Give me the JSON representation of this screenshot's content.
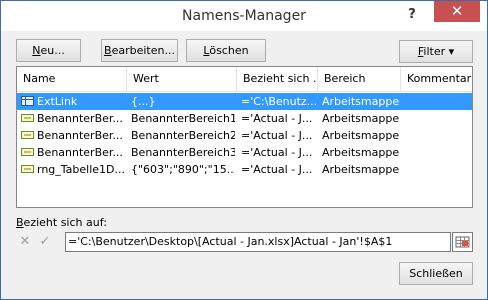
{
  "window": {
    "title": "Namens-Manager",
    "help": "?",
    "close": "✕"
  },
  "toolbar": {
    "new_mnemonic": "N",
    "new_rest": "eu...",
    "edit_mnemonic": "B",
    "edit_rest": "earbeiten...",
    "delete_mnemonic": "L",
    "delete_rest": "öschen",
    "filter_mnemonic": "F",
    "filter_rest": "ilter ▾"
  },
  "columns": [
    "Name",
    "Wert",
    "Bezieht sich ...",
    "Bereich",
    "Kommentar"
  ],
  "rows": [
    {
      "name": "ExtLink",
      "value": "{...}",
      "refers": "='C:\\Benutz...",
      "scope": "Arbeitsmappe",
      "comment": "",
      "icon": "table-icon",
      "selected": true
    },
    {
      "name": "BenannterBer...",
      "value": "BenannterBereich1",
      "refers": "='Actual - J...",
      "scope": "Arbeitsmappe",
      "comment": "",
      "icon": "name-icon",
      "selected": false
    },
    {
      "name": "BenannterBer...",
      "value": "BenannterBereich2",
      "refers": "='Actual - J...",
      "scope": "Arbeitsmappe",
      "comment": "",
      "icon": "name-icon",
      "selected": false
    },
    {
      "name": "BenannterBer...",
      "value": "BenannterBereich3",
      "refers": "='Actual - J...",
      "scope": "Arbeitsmappe",
      "comment": "",
      "icon": "name-icon",
      "selected": false
    },
    {
      "name": "rng_Tabelle1D...",
      "value": "{\"603\";\"890\";\"15...",
      "refers": "='Actual - J...",
      "scope": "Arbeitsmappe",
      "comment": "",
      "icon": "name-icon",
      "selected": false
    }
  ],
  "refers_label_mnemonic": "B",
  "refers_label_rest": "ezieht sich auf:",
  "refers_value": "='C:\\Benutzer\\Desktop\\[Actual - Jan.xlsx]Actual - Jan'!$A$1",
  "close_button": "Schließen",
  "colors": {
    "selection": "#3399ff",
    "close_bg": "#c75050"
  }
}
